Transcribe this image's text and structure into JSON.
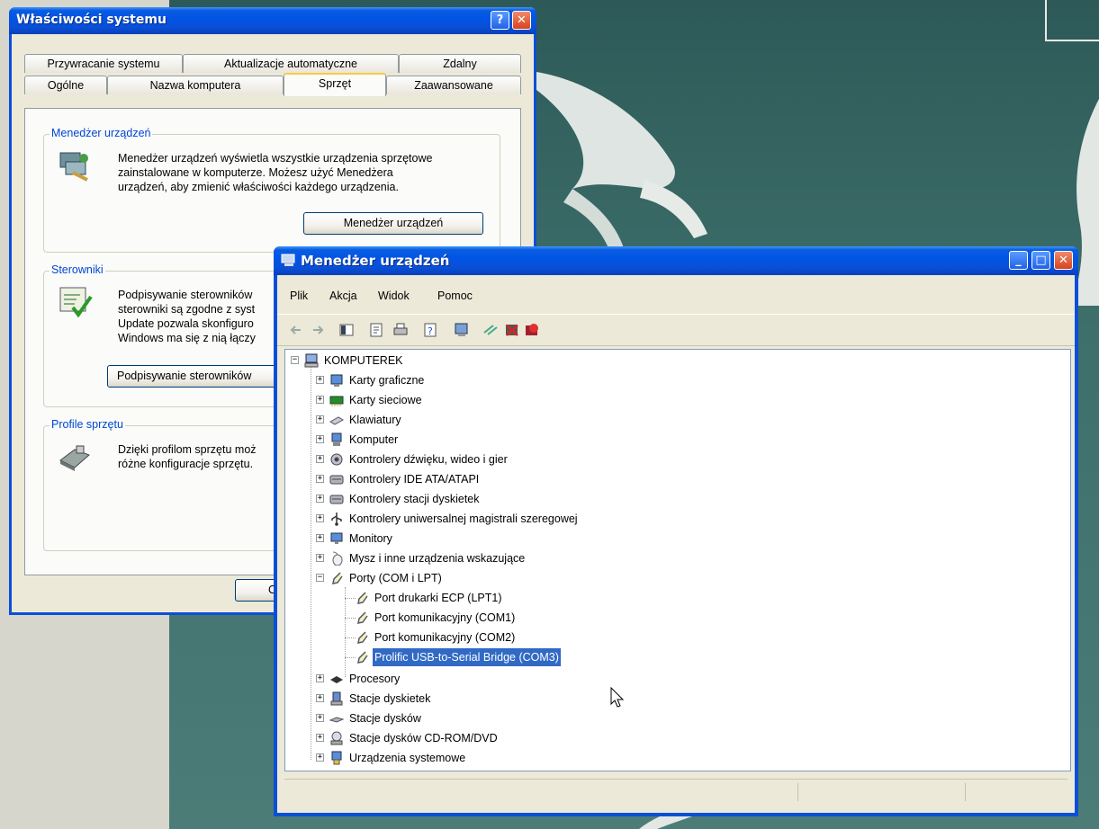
{
  "sysprops": {
    "title": "Właściwości systemu",
    "help_label": "?",
    "close_label": "✕",
    "tabs_row1": [
      "Przywracanie systemu",
      "Aktualizacje automatyczne",
      "Zdalny"
    ],
    "tabs_row2": [
      "Ogólne",
      "Nazwa komputera",
      "Sprzęt",
      "Zaawansowane"
    ],
    "active_tab": "Sprzęt",
    "groups": {
      "device_manager": {
        "legend": "Menedżer urządzeń",
        "lines": [
          "Menedżer urządzeń wyświetla wszystkie urządzenia sprzętowe",
          "zainstalowane w komputerze. Możesz użyć Menedżera",
          "urządzeń, aby zmienić właściwości każdego urządzenia."
        ],
        "button": "Menedżer urządzeń"
      },
      "drivers": {
        "legend": "Sterowniki",
        "lines": [
          "Podpisywanie sterowników",
          "sterowniki są zgodne z syst",
          "Update pozwala skonfiguro",
          "Windows ma się z nią łączy"
        ],
        "button": "Podpisywanie sterowników"
      },
      "profiles": {
        "legend": "Profile sprzętu",
        "lines": [
          "Dzięki profilom sprzętu moż",
          "różne konfiguracje sprzętu."
        ]
      }
    },
    "ok_button_partial": "O"
  },
  "devmgr": {
    "title": "Menedżer urządzeń",
    "minimize_label": "_",
    "maximize_label": "□",
    "close_label": "✕",
    "menu": [
      "Plik",
      "Akcja",
      "Widok",
      "Pomoc"
    ],
    "toolbar_icons": [
      "back-icon",
      "forward-icon",
      "console-tree-icon",
      "properties-icon",
      "print-icon",
      "help-icon",
      "scan-hardware-icon",
      "update-driver-icon",
      "uninstall-icon",
      "disable-icon"
    ],
    "root": "KOMPUTEREK",
    "categories": [
      "Karty graficzne",
      "Karty sieciowe",
      "Klawiatury",
      "Komputer",
      "Kontrolery dźwięku, wideo i gier",
      "Kontrolery IDE ATA/ATAPI",
      "Kontrolery stacji dyskietek",
      "Kontrolery uniwersalnej magistrali szeregowej",
      "Monitory",
      "Mysz i inne urządzenia wskazujące",
      "Porty (COM i LPT)"
    ],
    "ports_children": [
      "Port drukarki ECP (LPT1)",
      "Port komunikacyjny (COM1)",
      "Port komunikacyjny (COM2)",
      "Prolific USB-to-Serial Bridge (COM3)"
    ],
    "selected_item": "Prolific USB-to-Serial Bridge (COM3)",
    "categories_after": [
      "Procesory",
      "Stacje dyskietek",
      "Stacje dysków",
      "Stacje dysków CD-ROM/DVD",
      "Urządzenia systemowe"
    ]
  },
  "colors": {
    "title_blue": "#0a4fd7",
    "selection": "#316ac5",
    "legend_blue": "#0046d5"
  }
}
